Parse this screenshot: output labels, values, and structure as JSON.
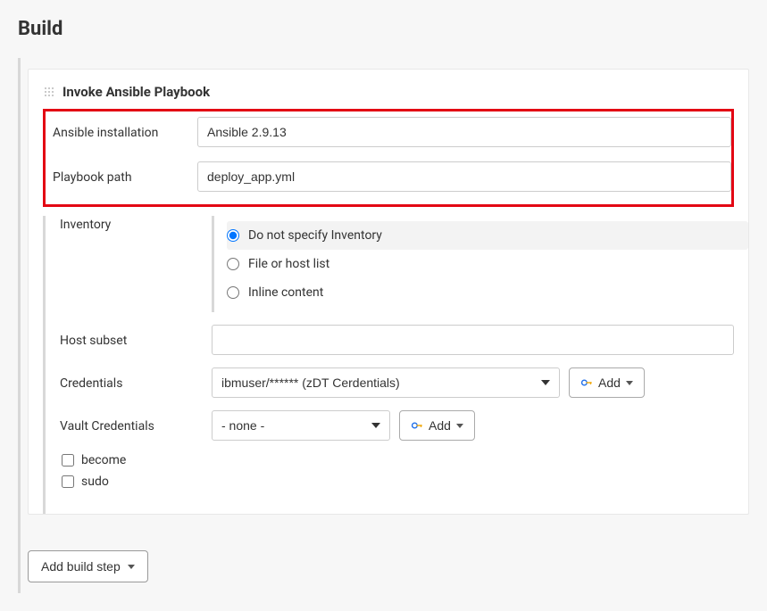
{
  "page": {
    "title": "Build"
  },
  "step": {
    "title": "Invoke Ansible Playbook",
    "fields": {
      "ansible_installation": {
        "label": "Ansible installation",
        "value": "Ansible 2.9.13"
      },
      "playbook_path": {
        "label": "Playbook path",
        "value": "deploy_app.yml"
      },
      "inventory": {
        "label": "Inventory",
        "options": {
          "none": "Do not specify Inventory",
          "file": "File or host list",
          "inline": "Inline content"
        },
        "selected": "none"
      },
      "host_subset": {
        "label": "Host subset",
        "value": ""
      },
      "credentials": {
        "label": "Credentials",
        "value": "ibmuser/****** (zDT Cerdentials)",
        "add_label": "Add"
      },
      "vault_credentials": {
        "label": "Vault Credentials",
        "value": "- none -",
        "add_label": "Add"
      },
      "become": {
        "label": "become",
        "checked": false
      },
      "sudo": {
        "label": "sudo",
        "checked": false
      }
    }
  },
  "footer": {
    "add_build_step_label": "Add build step"
  }
}
